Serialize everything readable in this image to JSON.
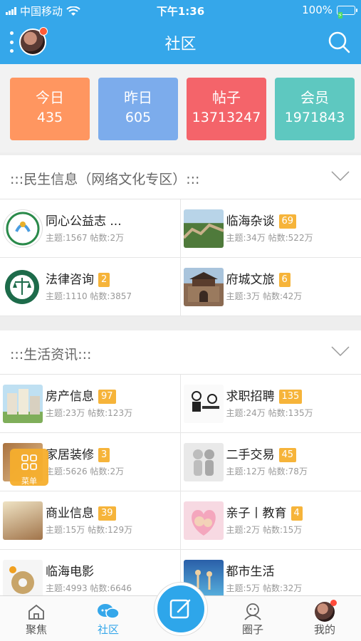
{
  "status_bar": {
    "carrier": "中国移动",
    "time": "下午1:36",
    "battery": "100%"
  },
  "header": {
    "title": "社区"
  },
  "stats": [
    {
      "label": "今日",
      "value": "435",
      "color": "#ff9660"
    },
    {
      "label": "昨日",
      "value": "605",
      "color": "#7cacec"
    },
    {
      "label": "帖子",
      "value": "13713247",
      "color": "#f4646a"
    },
    {
      "label": "会员",
      "value": "1971843",
      "color": "#5ec8c0"
    }
  ],
  "sections": [
    {
      "title": ":::民生信息（网络文化专区）:::",
      "forums": [
        {
          "name": "同心公益志 ...",
          "badge": "",
          "meta": "主题:1567 帖数:2万",
          "thumb": "charity-logo"
        },
        {
          "name": "临海杂谈",
          "badge": "69",
          "meta": "主题:34万 帖数:522万",
          "thumb": "great-wall"
        },
        {
          "name": "法律咨询",
          "badge": "2",
          "meta": "主题:1110 帖数:3857",
          "thumb": "justice-seal"
        },
        {
          "name": "府城文旅",
          "badge": "6",
          "meta": "主题:3万 帖数:42万",
          "thumb": "city-gate"
        }
      ]
    },
    {
      "title": ":::生活资讯:::",
      "forums": [
        {
          "name": "房产信息",
          "badge": "97",
          "meta": "主题:23万 帖数:123万",
          "thumb": "buildings"
        },
        {
          "name": "求职招聘",
          "badge": "135",
          "meta": "主题:24万 帖数:135万",
          "thumb": "office-cartoon"
        },
        {
          "name": "家居装修",
          "badge": "3",
          "meta": "主题:5626 帖数:2万",
          "thumb": "interior"
        },
        {
          "name": "二手交易",
          "badge": "45",
          "meta": "主题:12万 帖数:78万",
          "thumb": "figures"
        },
        {
          "name": "商业信息",
          "badge": "39",
          "meta": "主题:15万 帖数:129万",
          "thumb": "coins"
        },
        {
          "name": "亲子丨教育",
          "badge": "4",
          "meta": "主题:2万 帖数:15万",
          "thumb": "mother-child"
        },
        {
          "name": "临海电影",
          "badge": "",
          "meta": "主题:4993 帖数:6646",
          "thumb": "film-reel"
        },
        {
          "name": "都市生活",
          "badge": "",
          "meta": "主题:5万 帖数:32万",
          "thumb": "dance"
        }
      ]
    }
  ],
  "float_menu": {
    "label": "菜单"
  },
  "tabbar": {
    "items": [
      {
        "label": "聚焦",
        "icon": "home-icon"
      },
      {
        "label": "社区",
        "icon": "community-icon"
      },
      {
        "label": "圈子",
        "icon": "circle-icon"
      },
      {
        "label": "我的",
        "icon": "profile-avatar"
      }
    ],
    "post_icon": "edit-icon"
  }
}
